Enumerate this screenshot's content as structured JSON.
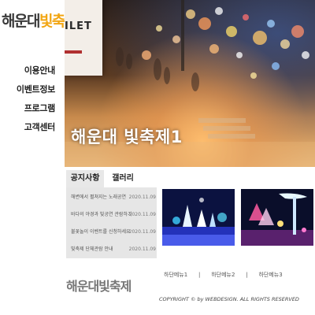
{
  "header": {
    "logo_part1": "해운대",
    "logo_part2": "빛축제"
  },
  "nav": {
    "items": [
      {
        "label": "이용안내"
      },
      {
        "label": "이벤트정보"
      },
      {
        "label": "프로그램"
      },
      {
        "label": "고객센터"
      }
    ]
  },
  "hero": {
    "title": "해운대 빛축제1",
    "sign_text": "ILET"
  },
  "tabs": {
    "notice": "공지사항",
    "gallery": "갤러리"
  },
  "notices": [
    {
      "title": "해변에서 펼쳐지는 노래공연",
      "date": "2020.11.09"
    },
    {
      "title": "바다의 야경과 빛공연 관람하기",
      "date": "2020.11.09"
    },
    {
      "title": "불꽃놀이 이벤트를 신청하세요",
      "date": "2020.11.09"
    },
    {
      "title": "빛축제 단체관람 안내",
      "date": "2020.11.09"
    }
  ],
  "footer": {
    "logo": "해운대빛축제",
    "menu": [
      "하단메뉴1",
      "하단메뉴2",
      "하단메뉴3"
    ],
    "separator": "|",
    "copyright": "COPYRIGHT © by WEBDESIGN. ALL RIGHTS RESERVED"
  }
}
